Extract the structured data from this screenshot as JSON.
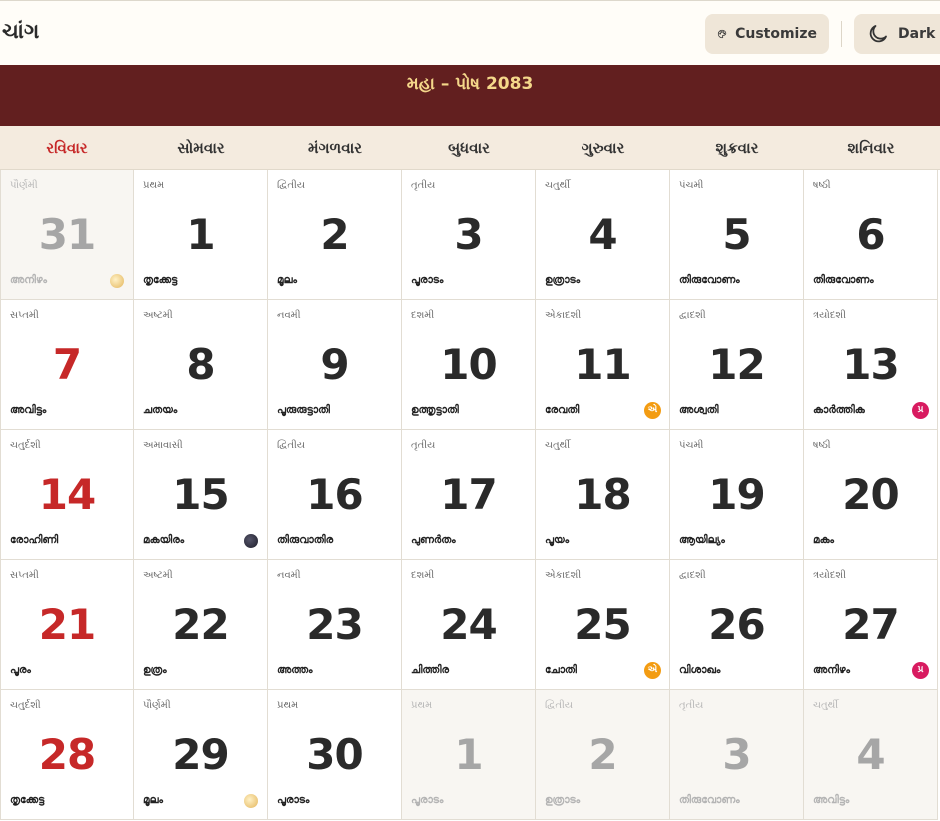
{
  "header": {
    "title": "ચાંગ",
    "customize_label": "Customize",
    "dark_label": "Dark"
  },
  "banner": {
    "subtitle": "મહા – પોષ 2083"
  },
  "colors": {
    "banner_bg": "#621f1f",
    "banner_text": "#f4d78a",
    "sunday_red": "#c62828",
    "ekadashi_orange": "#f39c12",
    "pradosh_pink": "#d81b60"
  },
  "weekdays": [
    "રવિવાર",
    "સોમવાર",
    "મંગળવાર",
    "બુધવાર",
    "ગુરુવાર",
    "શુક્રવાર",
    "શનિવાર"
  ],
  "days": [
    {
      "num": "31",
      "tithi": "પૌર્ણમી",
      "nak": "അനിഴം",
      "muted": true,
      "sunday": true,
      "marker": "full-moon"
    },
    {
      "num": "1",
      "tithi": "પ્રથમ",
      "nak": "തൃക്കേട്ട"
    },
    {
      "num": "2",
      "tithi": "દ્વિતીય",
      "nak": "മൂലം"
    },
    {
      "num": "3",
      "tithi": "તૃતીય",
      "nak": "പൂരാടം"
    },
    {
      "num": "4",
      "tithi": "ચતુર્થી",
      "nak": "ഉത്രാടം"
    },
    {
      "num": "5",
      "tithi": "પંચમી",
      "nak": "തിരുവോണം"
    },
    {
      "num": "6",
      "tithi": "ષષ્ઠી",
      "nak": "തിരുവോണം"
    },
    {
      "num": "7",
      "tithi": "સપ્તમી",
      "nak": "അവിട്ടം",
      "sunday": true
    },
    {
      "num": "8",
      "tithi": "અષ્ટમી",
      "nak": "ചതയം"
    },
    {
      "num": "9",
      "tithi": "નવમી",
      "nak": "പൂരുരുട്ടാതി"
    },
    {
      "num": "10",
      "tithi": "દશમી",
      "nak": "ഉത്തൃട്ടാതി"
    },
    {
      "num": "11",
      "tithi": "એકાદશી",
      "nak": "രേവതി",
      "marker": "ekadashi",
      "badge": "એ"
    },
    {
      "num": "12",
      "tithi": "દ્વાદશી",
      "nak": "അശ്വതി"
    },
    {
      "num": "13",
      "tithi": "ત્રયોદશી",
      "nak": "കാർത്തിക",
      "marker": "pradosh",
      "badge": "પ્ર"
    },
    {
      "num": "14",
      "tithi": "ચતુર્દશી",
      "nak": "രോഹിണി",
      "sunday": true
    },
    {
      "num": "15",
      "tithi": "અમાવાસી",
      "nak": "മകയിരം",
      "marker": "new-moon"
    },
    {
      "num": "16",
      "tithi": "દ્વિતીય",
      "nak": "തിരുവാതിര"
    },
    {
      "num": "17",
      "tithi": "તૃતીય",
      "nak": "പുണർതം"
    },
    {
      "num": "18",
      "tithi": "ચતુર્થી",
      "nak": "പൂയം"
    },
    {
      "num": "19",
      "tithi": "પંચમી",
      "nak": "ആയില്യം"
    },
    {
      "num": "20",
      "tithi": "ષષ્ઠી",
      "nak": "മകം"
    },
    {
      "num": "21",
      "tithi": "સપ્તમી",
      "nak": "പൂരം",
      "sunday": true
    },
    {
      "num": "22",
      "tithi": "અષ્ટમી",
      "nak": "ഉത്രം"
    },
    {
      "num": "23",
      "tithi": "નવમી",
      "nak": "അത്തം"
    },
    {
      "num": "24",
      "tithi": "દશમી",
      "nak": "ചിത്തിര"
    },
    {
      "num": "25",
      "tithi": "એકાદશી",
      "nak": "ചോതി",
      "marker": "ekadashi",
      "badge": "એ"
    },
    {
      "num": "26",
      "tithi": "દ્વાદશી",
      "nak": "വിശാഖം"
    },
    {
      "num": "27",
      "tithi": "ત્રયોદશી",
      "nak": "അനിഴം",
      "marker": "pradosh",
      "badge": "પ્ર"
    },
    {
      "num": "28",
      "tithi": "ચતુર્દશી",
      "nak": "തൃക്കേട്ട",
      "sunday": true
    },
    {
      "num": "29",
      "tithi": "પૌર્ણમી",
      "nak": "മൂലം",
      "marker": "full-moon"
    },
    {
      "num": "30",
      "tithi": "પ્રથમ",
      "nak": "പൂരാടം"
    },
    {
      "num": "1",
      "tithi": "પ્રથમ",
      "nak": "പൂരാടം",
      "muted": true
    },
    {
      "num": "2",
      "tithi": "દ્વિતીય",
      "nak": "ഉത്രാടം",
      "muted": true
    },
    {
      "num": "3",
      "tithi": "તૃતીય",
      "nak": "തിരുവോണം",
      "muted": true
    },
    {
      "num": "4",
      "tithi": "ચતુર્થી",
      "nak": "അവിട്ടം",
      "muted": true
    }
  ]
}
